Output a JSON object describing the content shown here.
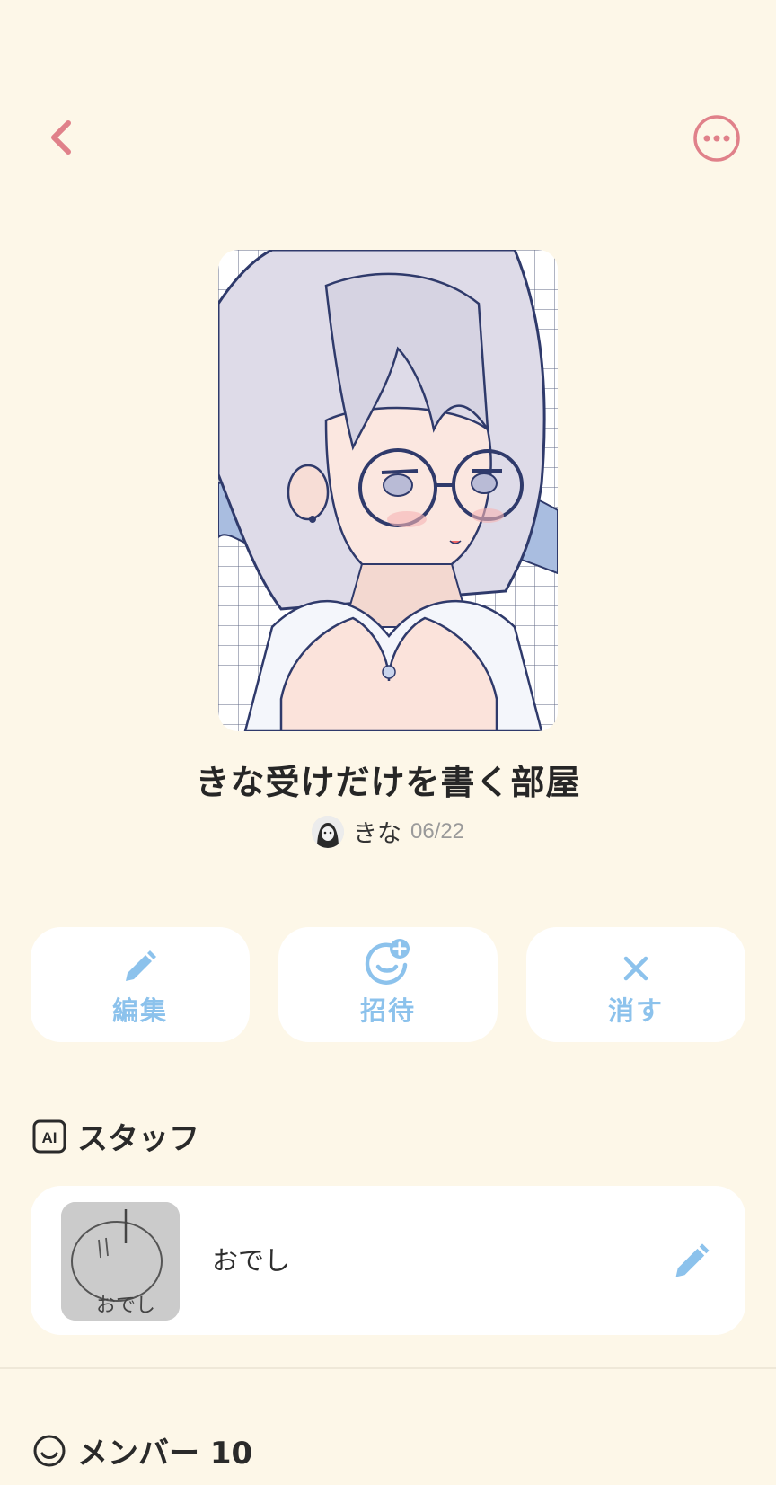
{
  "header": {
    "back_icon": "chevron-left-icon",
    "more_icon": "more-horizontal-circle-icon",
    "accent_color": "#e0818a"
  },
  "room": {
    "title": "きな受けだけを書く部屋",
    "author_name": "きな",
    "date": "06/22"
  },
  "actions": [
    {
      "label": "編集",
      "icon": "pencil-icon"
    },
    {
      "label": "招待",
      "icon": "smiley-add-icon"
    },
    {
      "label": "消す",
      "icon": "close-icon"
    }
  ],
  "action_color": "#8cc2ec",
  "staff": {
    "section_title": "スタッフ",
    "section_icon": "ai-badge-icon",
    "member": {
      "name": "おでし",
      "avatar_caption": "おでし",
      "edit_icon": "pencil-icon"
    }
  },
  "members": {
    "section_title": "メンバー 10",
    "section_icon": "smiley-icon"
  }
}
